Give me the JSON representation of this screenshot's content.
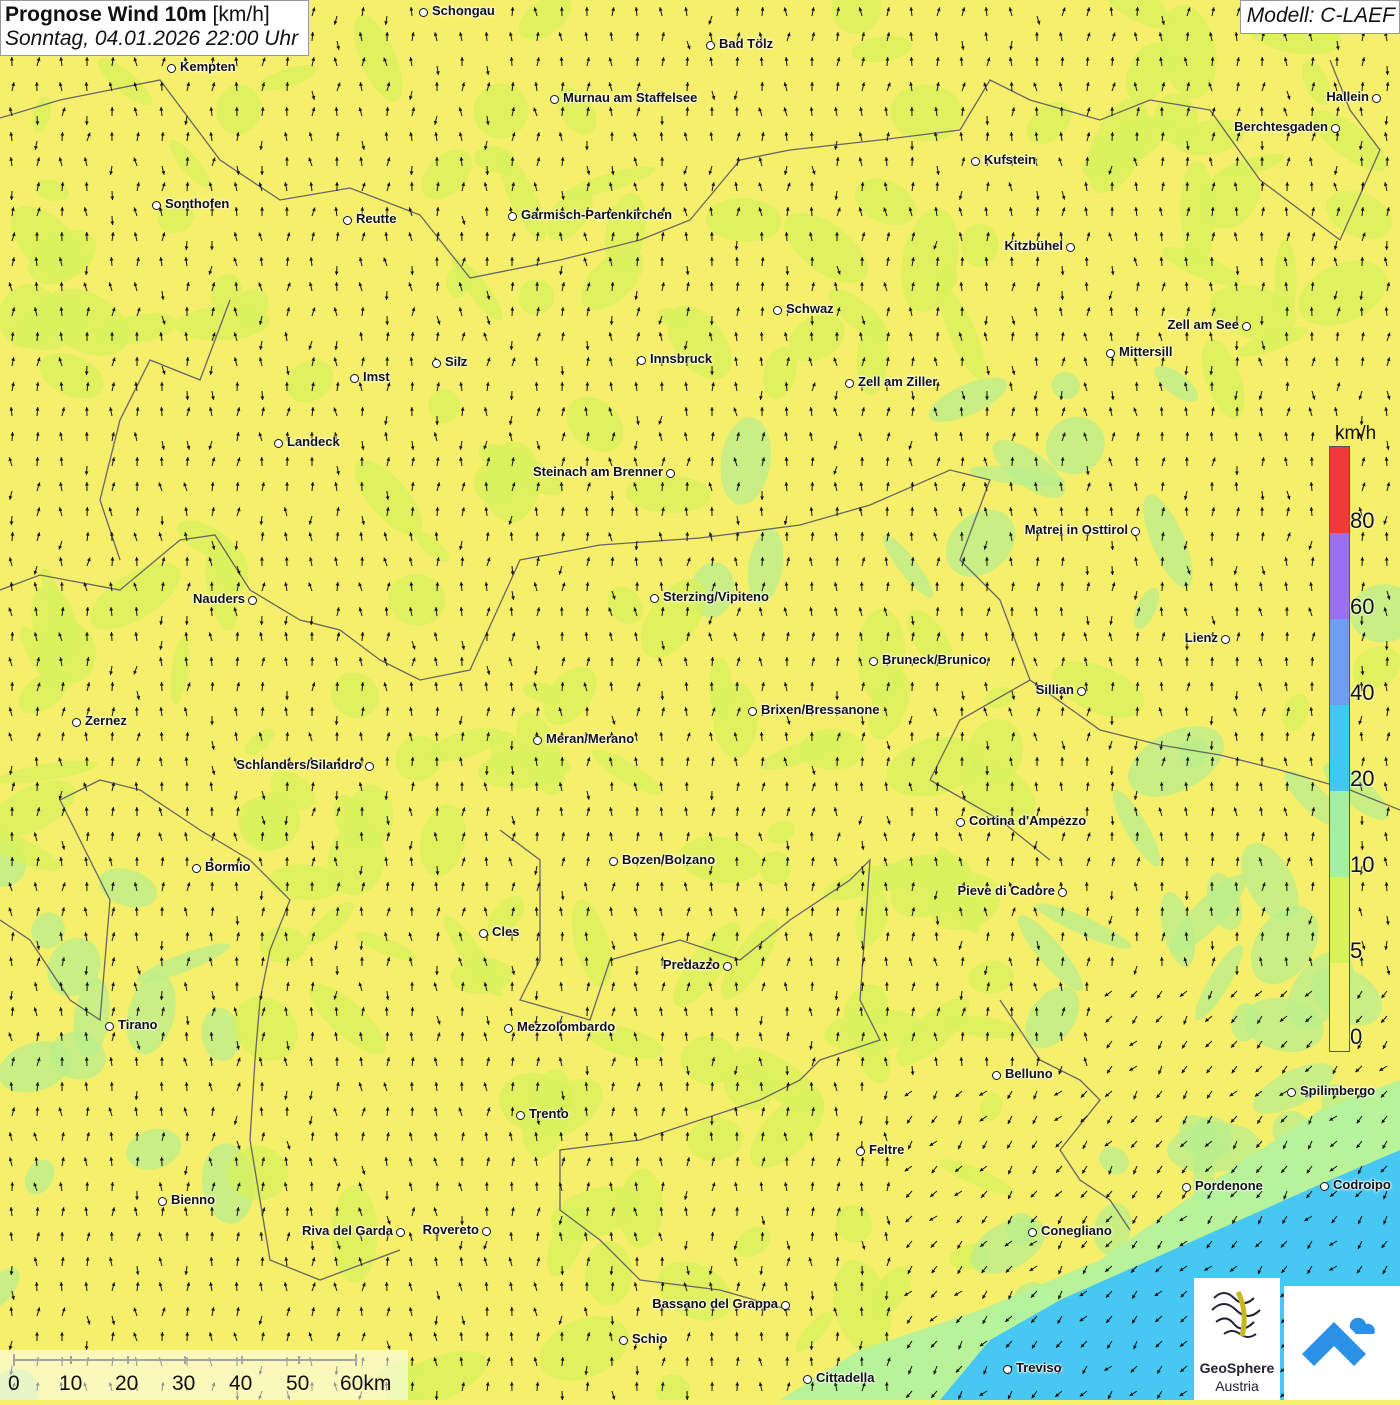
{
  "header": {
    "title_bold": "Prognose Wind 10m",
    "title_unit": "[km/h]",
    "datetime": "Sonntag, 04.01.2026 22:00 Uhr",
    "model": "Modell: C-LAEF"
  },
  "legend": {
    "unit": "km/h",
    "ticks": [
      "0",
      "5",
      "10",
      "20",
      "40",
      "60",
      "80"
    ],
    "colors": [
      "#f7f06a",
      "#d8f25c",
      "#a2f0a0",
      "#3fc8f2",
      "#6f9df2",
      "#9a6ff0",
      "#f03a3a"
    ]
  },
  "scale": {
    "labels": [
      "0",
      "10",
      "20",
      "30",
      "40",
      "50",
      "60km"
    ]
  },
  "logos": {
    "geosphere_line1": "GeoSphere",
    "geosphere_line2": "Austria"
  },
  "cities": [
    {
      "name": "Schongau"
    },
    {
      "name": "Bad Tölz"
    },
    {
      "name": "Kempten"
    },
    {
      "name": "Murnau am Staffelsee"
    },
    {
      "name": "Hallein"
    },
    {
      "name": "Berchtesgaden"
    },
    {
      "name": "Kufstein"
    },
    {
      "name": "Sonthofen"
    },
    {
      "name": "Reutte"
    },
    {
      "name": "Garmisch-Partenkirchen"
    },
    {
      "name": "Kitzbühel"
    },
    {
      "name": "Schwaz"
    },
    {
      "name": "Zell am See"
    },
    {
      "name": "Mittersill"
    },
    {
      "name": "Innsbruck"
    },
    {
      "name": "Silz"
    },
    {
      "name": "Imst"
    },
    {
      "name": "Zell am Ziller"
    },
    {
      "name": "Landeck"
    },
    {
      "name": "Steinach am Brenner"
    },
    {
      "name": "Matrei in Osttirol"
    },
    {
      "name": "Nauders"
    },
    {
      "name": "Sterzing/Vipiteno"
    },
    {
      "name": "Lienz"
    },
    {
      "name": "Bruneck/Brunico"
    },
    {
      "name": "Sillian"
    },
    {
      "name": "Brixen/Bressanone"
    },
    {
      "name": "Zernez"
    },
    {
      "name": "Meran/Merano"
    },
    {
      "name": "Schlanders/Silandro"
    },
    {
      "name": "Cortina d'Ampezzo"
    },
    {
      "name": "Bozen/Bolzano"
    },
    {
      "name": "Bormio"
    },
    {
      "name": "Pieve di Cadore"
    },
    {
      "name": "Cles"
    },
    {
      "name": "Predazzo"
    },
    {
      "name": "Tirano"
    },
    {
      "name": "Mezzolombardo"
    },
    {
      "name": "Belluno"
    },
    {
      "name": "Spilimbergo"
    },
    {
      "name": "Trento"
    },
    {
      "name": "Feltre"
    },
    {
      "name": "Pordenone"
    },
    {
      "name": "Codroipo"
    },
    {
      "name": "Bienno"
    },
    {
      "name": "Riva del Garda"
    },
    {
      "name": "Rovereto"
    },
    {
      "name": "Conegliano"
    },
    {
      "name": "Bassano del Grappa"
    },
    {
      "name": "Schio"
    },
    {
      "name": "Treviso"
    },
    {
      "name": "Cittadella"
    }
  ]
}
